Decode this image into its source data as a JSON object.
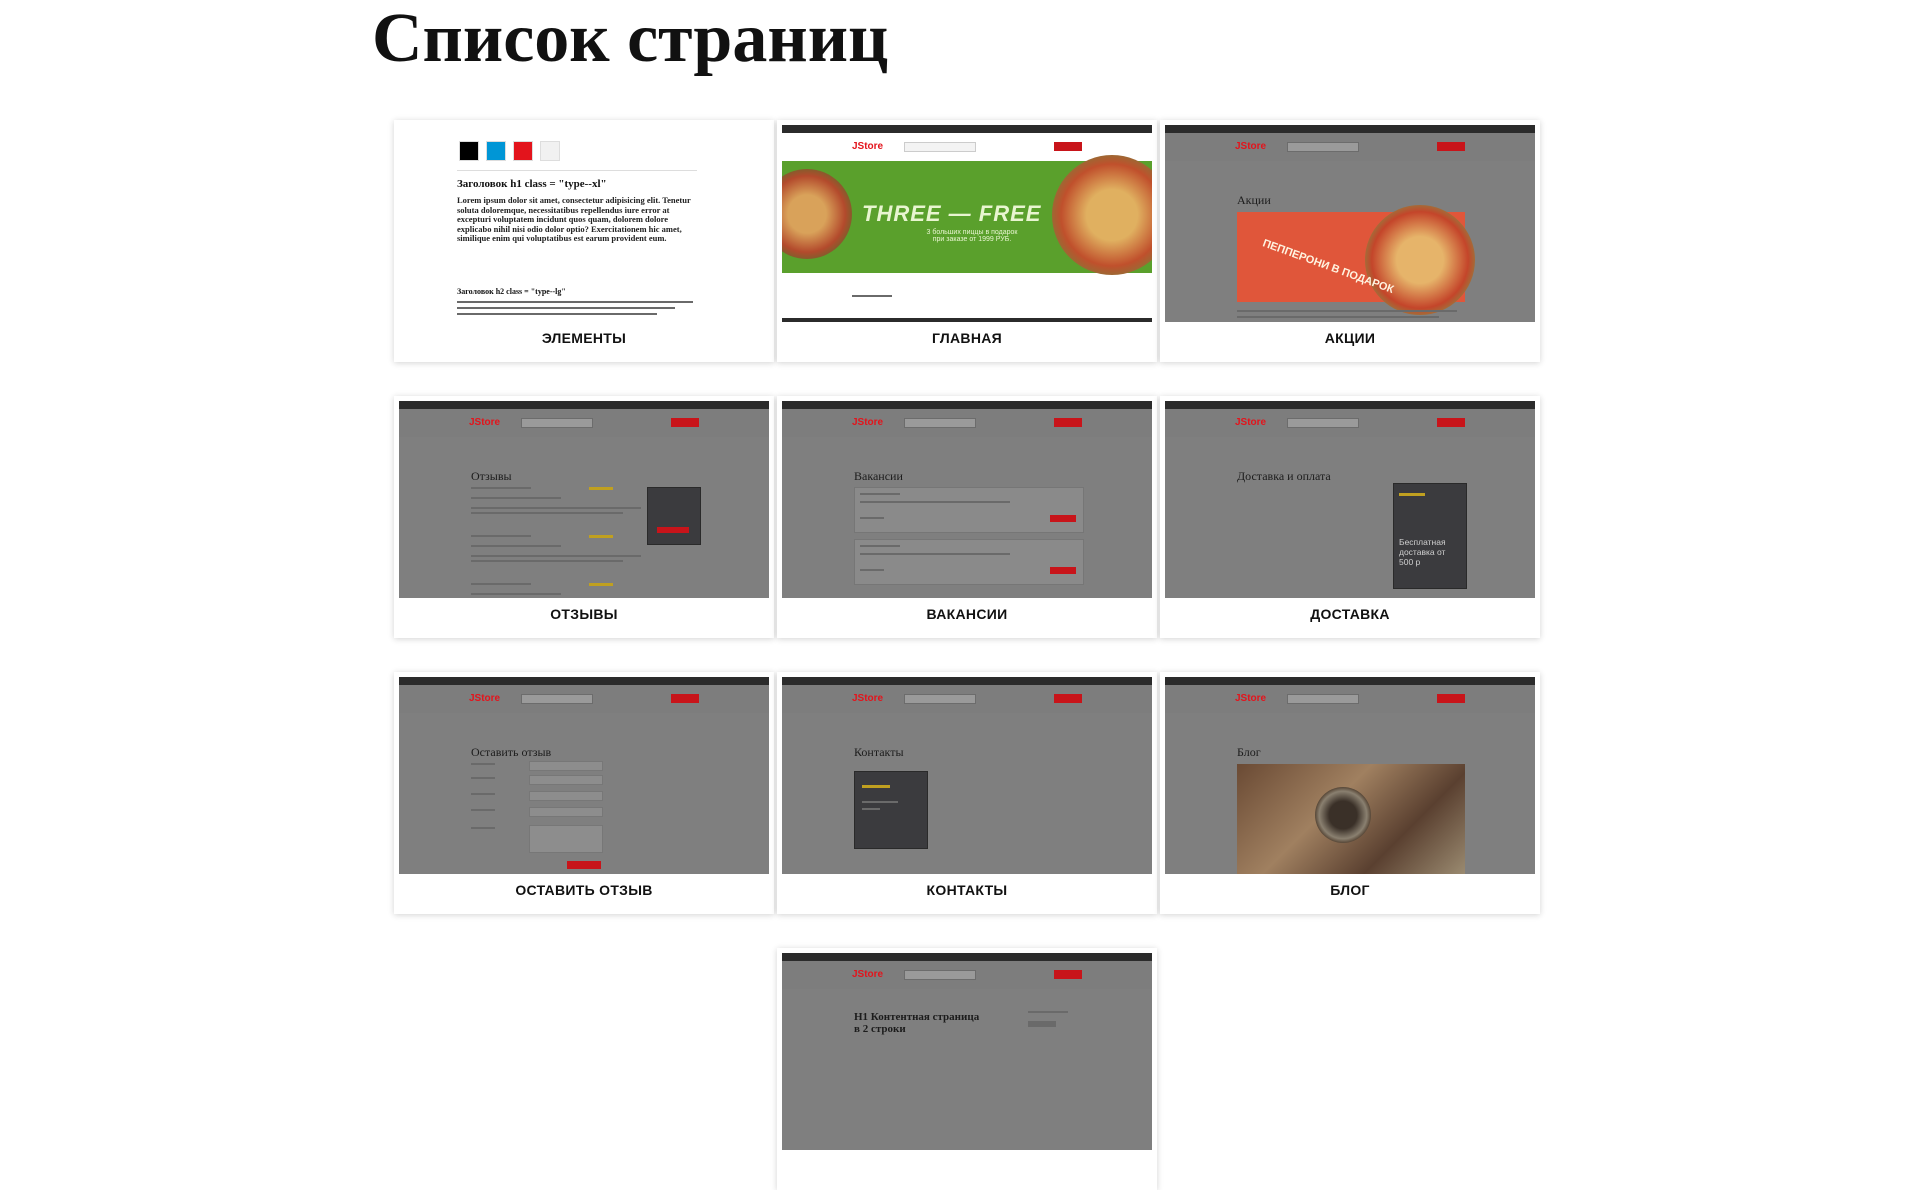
{
  "page": {
    "title": "Список страниц"
  },
  "cards": [
    {
      "label": "Элементы",
      "kind": "elements"
    },
    {
      "label": "Главная",
      "kind": "home"
    },
    {
      "label": "Акции",
      "kind": "promo"
    },
    {
      "label": "Отзывы",
      "kind": "reviews"
    },
    {
      "label": "Вакансии",
      "kind": "vacancies"
    },
    {
      "label": "Доставка",
      "kind": "delivery"
    },
    {
      "label": "Оставить отзыв",
      "kind": "leave-review"
    },
    {
      "label": "Контакты",
      "kind": "contacts"
    },
    {
      "label": "Блог",
      "kind": "blog"
    },
    {
      "label": "",
      "kind": "content"
    }
  ],
  "thumbs": {
    "logo": "JStore",
    "elements": {
      "heading1": "Заголовок h1 class = \"type--xl\"",
      "paragraph": "Lorem ipsum dolor sit amet, consectetur adipisicing elit. Tenetur soluta doloremque, necessitatibus repellendus iure error at excepturi voluptatem incidunt quos quam, dolorem dolore explicabo nihil nisi odio dolor optio? Exercitationem hic amet, similique enim qui voluptatibus est earum provident eum.",
      "heading2": "Заголовок h2 class = \"type--lg\"",
      "swatches": [
        "#000000",
        "#0096d6",
        "#e3141c",
        "#f1f1f1"
      ]
    },
    "home_banner": "THREE — FREE",
    "home_sub": "3 больших пиццы в подарок\nпри заказе от 1999 РУБ.",
    "promo_title": "Акции",
    "promo_banner": "ПЕППЕРОНИ В ПОДАРОК",
    "reviews_title": "Отзывы",
    "vacancies_title": "Вакансии",
    "delivery_title": "Доставка и оплата",
    "delivery_box": "Бесплатная\nдоставка от\n500 р",
    "leave_review_title": "Оставить отзыв",
    "contacts_title": "Контакты",
    "blog_title": "Блог",
    "content_title": "H1 Контентная страница\nв 2 строки"
  },
  "colors": {
    "accent": "#e3141c",
    "dark": "#2b2b2b",
    "green": "#5aa02c"
  }
}
